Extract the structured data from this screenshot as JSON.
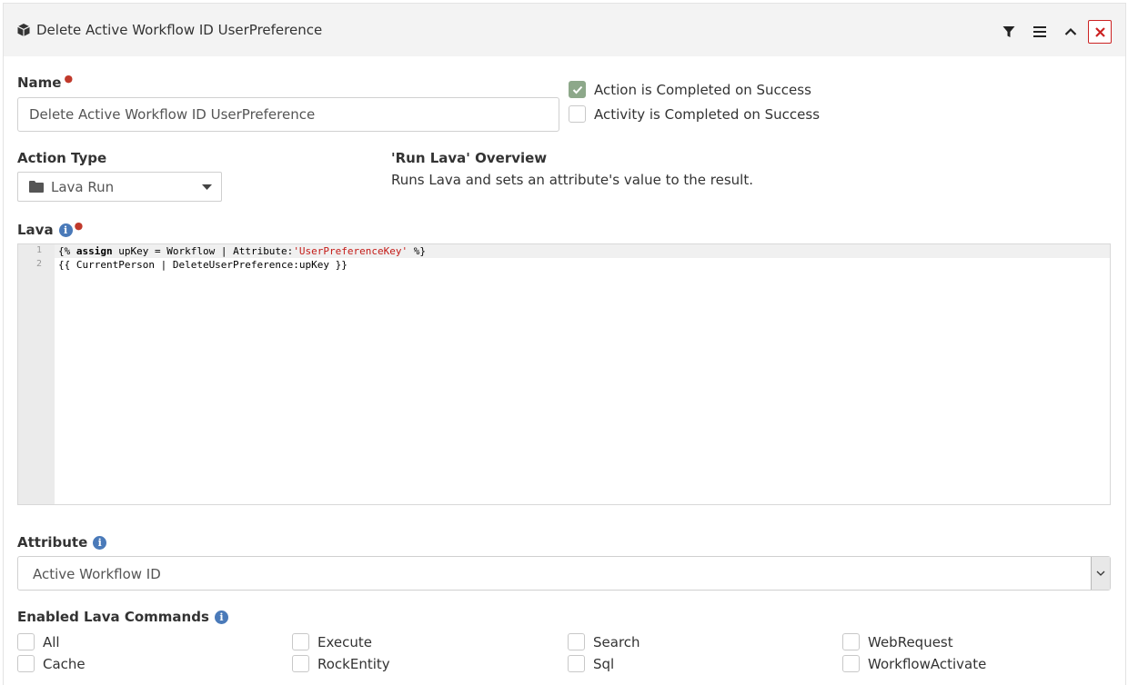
{
  "header": {
    "title": "Delete Active Workflow ID UserPreference",
    "icons": [
      "cube-icon",
      "filter-icon",
      "menu-icon",
      "chevron-up-icon",
      "close-icon"
    ]
  },
  "name_field": {
    "label": "Name",
    "value": "Delete Active Workflow ID UserPreference"
  },
  "completion": {
    "action_completed_label": "Action is Completed on Success",
    "action_completed_checked": true,
    "activity_completed_label": "Activity is Completed on Success",
    "activity_completed_checked": false
  },
  "action_type": {
    "label": "Action Type",
    "value": "Lava Run"
  },
  "overview": {
    "title": "'Run Lava' Overview",
    "text": "Runs Lava and sets an attribute's value to the result."
  },
  "lava": {
    "label": "Lava",
    "line_numbers": [
      "1",
      "2"
    ],
    "line1": {
      "open": "{% ",
      "keyword": "assign",
      "mid": " upKey = Workflow | Attribute:",
      "string": "'UserPreferenceKey'",
      "close": " %}"
    },
    "line2": "{{ CurrentPerson | DeleteUserPreference:upKey }}"
  },
  "attribute": {
    "label": "Attribute",
    "value": "Active Workflow ID"
  },
  "lava_commands": {
    "label": "Enabled Lava Commands",
    "options": [
      {
        "label": "All",
        "checked": false
      },
      {
        "label": "Cache",
        "checked": false
      },
      {
        "label": "Execute",
        "checked": false
      },
      {
        "label": "RockEntity",
        "checked": false
      },
      {
        "label": "Search",
        "checked": false
      },
      {
        "label": "Sql",
        "checked": false
      },
      {
        "label": "WebRequest",
        "checked": false
      },
      {
        "label": "WorkflowActivate",
        "checked": false
      }
    ]
  },
  "colors": {
    "required": "#c0392b",
    "checkbox_checked": "#8da88a",
    "info": "#4a7ab9",
    "close": "#cc2222",
    "string": "#c41a16"
  }
}
